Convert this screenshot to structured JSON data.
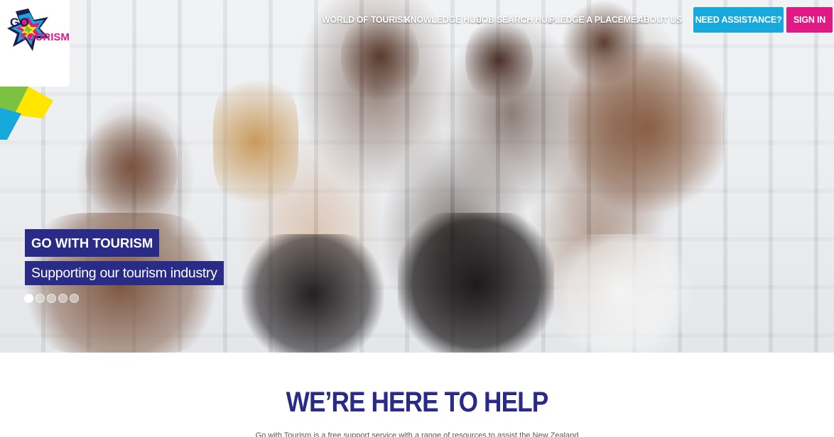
{
  "logo": {
    "line1": "GO",
    "line2": "TOURISM",
    "colors": [
      "#e01a84",
      "#17a8dc",
      "#7cc242",
      "#ffe600",
      "#1d1d4f"
    ]
  },
  "nav": {
    "items": [
      {
        "label": "WORLD OF TOURISM"
      },
      {
        "label": "KNOWLEDGE HUB"
      },
      {
        "label": "JOB SEARCH HUB"
      },
      {
        "label": "PLEDGE A PLACEMENT"
      },
      {
        "label": "ABOUT US"
      }
    ],
    "assist_label": "NEED ASSISTANCE?",
    "signin_label": "SIGN IN"
  },
  "hero": {
    "heading": "GO WITH TOURISM",
    "subheading": "Supporting our tourism industry",
    "slide_count": 5,
    "active_slide": 1
  },
  "section": {
    "title": "WE’RE HERE TO HELP",
    "intro": "Go with Tourism is a free support service with a range of resources to assist the New Zealand"
  },
  "colors": {
    "navy": "#2a2b86",
    "pink": "#e01a84",
    "blue": "#17a8dc"
  }
}
